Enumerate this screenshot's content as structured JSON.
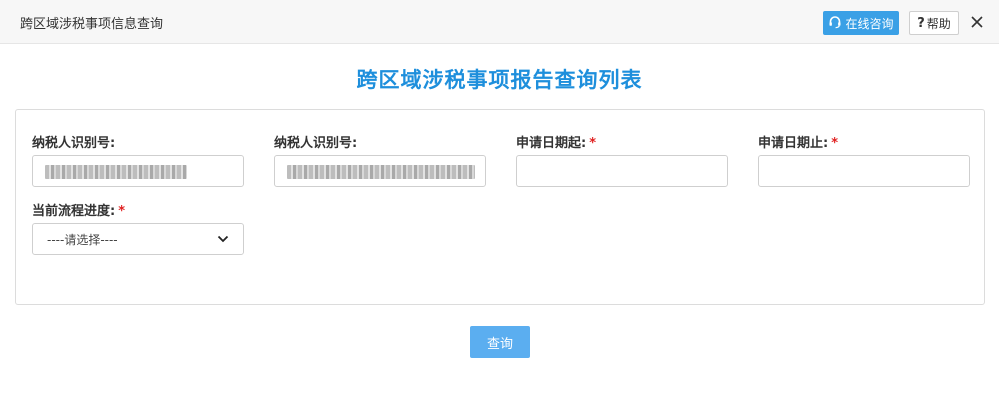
{
  "window": {
    "title": "跨区域涉税事项信息查询",
    "online_consult_label": "在线咨询",
    "help_label": "帮助",
    "help_glyph": "?",
    "close_icon": "close-icon",
    "headset_icon": "headset-icon"
  },
  "page": {
    "heading": "跨区域涉税事项报告查询列表"
  },
  "form": {
    "taxpayer_id_1": {
      "label": "纳税人识别号:"
    },
    "taxpayer_id_2": {
      "label": "纳税人识别号:"
    },
    "date_start": {
      "label": "申请日期起:",
      "required_mark": "*",
      "value": ""
    },
    "date_end": {
      "label": "申请日期止:",
      "required_mark": "*",
      "value": ""
    },
    "process_status": {
      "label": "当前流程进度:",
      "required_mark": "*",
      "selected": "----请选择----"
    }
  },
  "actions": {
    "query_label": "查询"
  },
  "colors": {
    "accent": "#1e8fdc",
    "online_button": "#3aa0e6",
    "query_button": "#5baef0",
    "required": "#e02020"
  }
}
